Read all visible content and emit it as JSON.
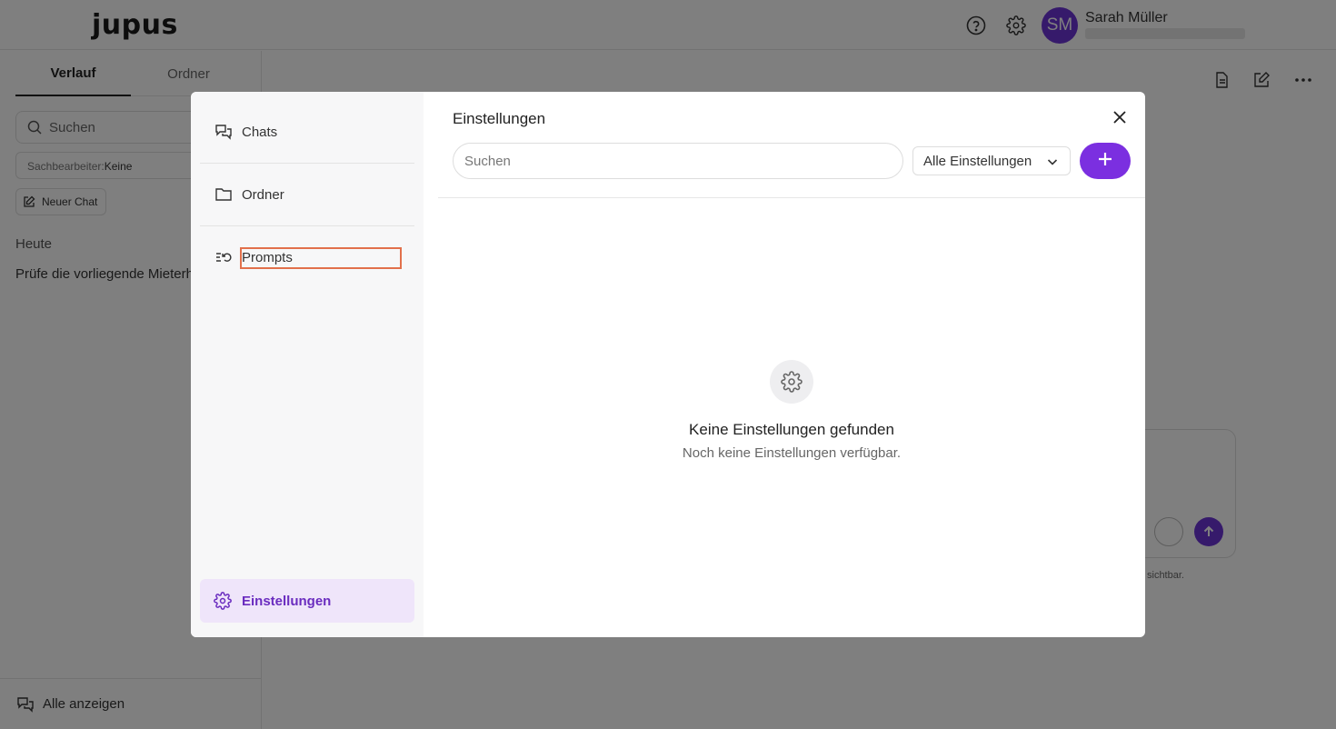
{
  "app": {
    "logo": "jupus"
  },
  "user": {
    "initials": "SM",
    "name": "Sarah Müller"
  },
  "left_panel": {
    "tabs": [
      "Verlauf",
      "Ordner"
    ],
    "search_placeholder": "Suchen",
    "filter_label": "Sachbearbeiter:",
    "filter_value": "Keine",
    "new_chat": "Neuer Chat",
    "section_today": "Heute",
    "recent_chat": "Prüfe die vorliegende Mieterh",
    "show_all": "Alle anzeigen"
  },
  "composer": {
    "hint": "sichtbar."
  },
  "modal": {
    "nav": {
      "chats": "Chats",
      "folders": "Ordner",
      "prompts": "Prompts",
      "settings": "Einstellungen"
    },
    "title": "Einstellungen",
    "search_placeholder": "Suchen",
    "filter_select": "Alle Einstellungen",
    "empty_title": "Keine Einstellungen gefunden",
    "empty_subtitle": "Noch keine Einstellungen verfügbar."
  },
  "colors": {
    "accent": "#7b2fe0",
    "accent_soft": "#efe5fa",
    "highlight_outline": "#e2704b"
  }
}
